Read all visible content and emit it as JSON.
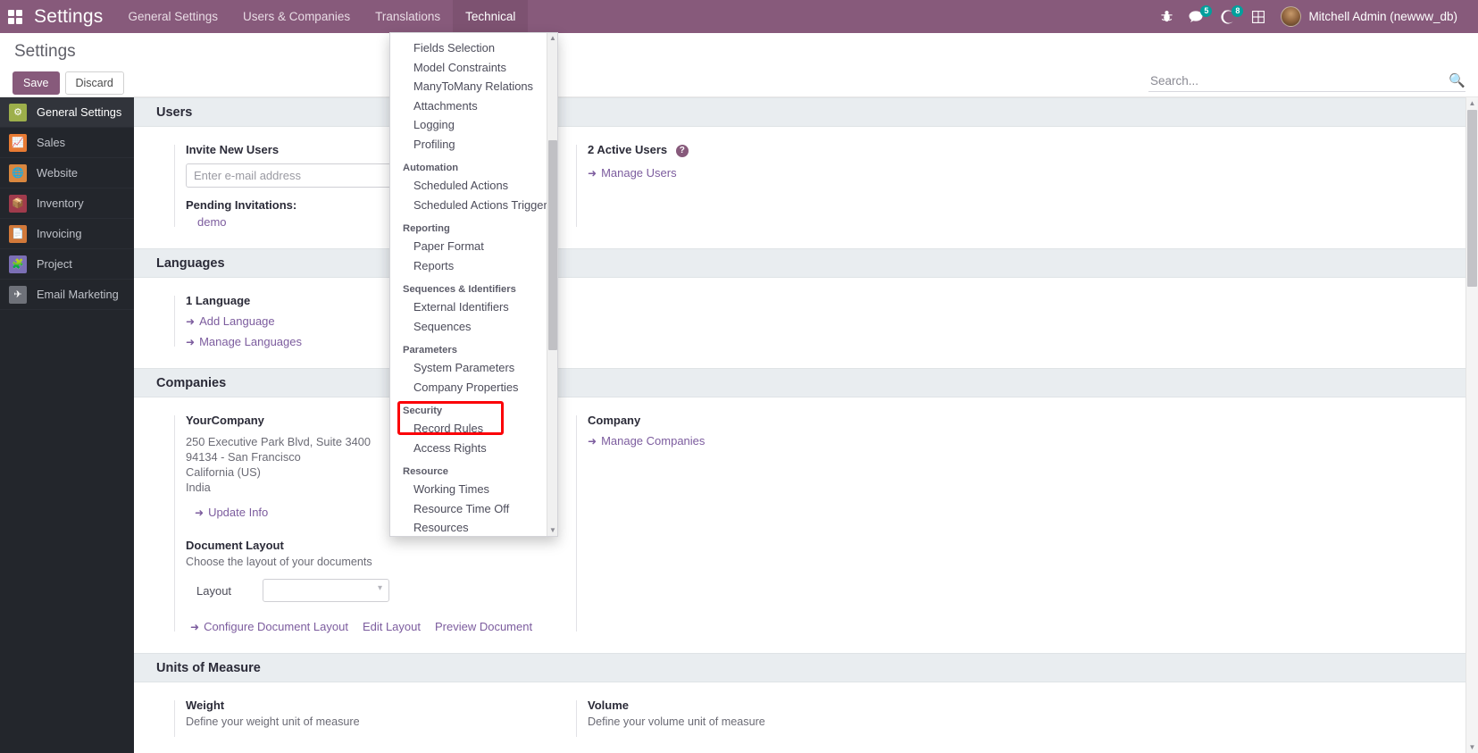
{
  "topbar": {
    "apps_icon": "grid-apps-icon",
    "brand": "Settings",
    "menus": [
      {
        "label": "General Settings",
        "active": false
      },
      {
        "label": "Users & Companies",
        "active": false
      },
      {
        "label": "Translations",
        "active": false
      },
      {
        "label": "Technical",
        "active": true
      }
    ],
    "systray": {
      "debug_icon": "bug-icon",
      "messages_icon": "chat-bubble-icon",
      "messages_count": "5",
      "activities_icon": "clock-activity-icon",
      "activities_count": "8",
      "apps_grid_icon": "grid-plus-icon"
    },
    "user": "Mitchell Admin (newww_db)"
  },
  "control_panel": {
    "title": "Settings",
    "save_label": "Save",
    "discard_label": "Discard",
    "search_placeholder": "Search...",
    "search_value": "",
    "search_icon": "magnifier-icon"
  },
  "sidebar": {
    "items": [
      {
        "label": "General Settings",
        "icon": "gear-icon",
        "color": "#9DAF4B",
        "active": true
      },
      {
        "label": "Sales",
        "icon": "chart-line-icon",
        "color": "#E87B33",
        "active": false
      },
      {
        "label": "Website",
        "icon": "globe-icon",
        "color": "#D9873F",
        "active": false
      },
      {
        "label": "Inventory",
        "icon": "box-open-icon",
        "color": "#A03B4C",
        "active": false
      },
      {
        "label": "Invoicing",
        "icon": "invoice-icon",
        "color": "#D2793A",
        "active": false
      },
      {
        "label": "Project",
        "icon": "puzzle-icon",
        "color": "#7B6FB5",
        "active": false
      },
      {
        "label": "Email Marketing",
        "icon": "paper-plane-icon",
        "color": "#6E7179",
        "active": false
      }
    ]
  },
  "sections": {
    "users": {
      "header": "Users",
      "invite_label": "Invite New Users",
      "invite_placeholder": "Enter e-mail address",
      "invite_value": "",
      "pending_label": "Pending Invitations:",
      "pending_items": [
        "demo"
      ],
      "active_users_label": "2 Active Users",
      "active_users_help": "help-icon",
      "manage_users_link": "Manage Users"
    },
    "languages": {
      "header": "Languages",
      "count_label": "1 Language",
      "add_link": "Add Language",
      "manage_link": "Manage Languages"
    },
    "companies": {
      "header": "Companies",
      "company_name": "YourCompany",
      "address_lines": [
        "250 Executive Park Blvd, Suite 3400",
        "94134 - San Francisco",
        "California (US)",
        "India"
      ],
      "update_info_link": "Update Info",
      "right_title": "Company",
      "manage_companies_link": "Manage Companies",
      "document_layout_label": "Document Layout",
      "document_layout_sub": "Choose the layout of your documents",
      "layout_field_label": "Layout",
      "layout_value": "",
      "configure_link": "Configure Document Layout",
      "edit_layout_link": "Edit Layout",
      "preview_link": "Preview Document"
    },
    "uom": {
      "header": "Units of Measure",
      "weight_label": "Weight",
      "weight_sub": "Define your weight unit of measure",
      "volume_label": "Volume",
      "volume_sub": "Define your volume unit of measure"
    }
  },
  "dropdown": {
    "entries": [
      {
        "type": "item",
        "label": "Fields Selection"
      },
      {
        "type": "item",
        "label": "Model Constraints"
      },
      {
        "type": "item",
        "label": "ManyToMany Relations"
      },
      {
        "type": "item",
        "label": "Attachments"
      },
      {
        "type": "item",
        "label": "Logging"
      },
      {
        "type": "item",
        "label": "Profiling"
      },
      {
        "type": "group",
        "label": "Automation"
      },
      {
        "type": "item",
        "label": "Scheduled Actions"
      },
      {
        "type": "item",
        "label": "Scheduled Actions Triggers"
      },
      {
        "type": "group",
        "label": "Reporting"
      },
      {
        "type": "item",
        "label": "Paper Format"
      },
      {
        "type": "item",
        "label": "Reports"
      },
      {
        "type": "group",
        "label": "Sequences & Identifiers"
      },
      {
        "type": "item",
        "label": "External Identifiers"
      },
      {
        "type": "item",
        "label": "Sequences"
      },
      {
        "type": "group",
        "label": "Parameters"
      },
      {
        "type": "item",
        "label": "System Parameters"
      },
      {
        "type": "item",
        "label": "Company Properties"
      },
      {
        "type": "group",
        "label": "Security"
      },
      {
        "type": "item",
        "label": "Record Rules"
      },
      {
        "type": "item",
        "label": "Access Rights"
      },
      {
        "type": "group",
        "label": "Resource"
      },
      {
        "type": "item",
        "label": "Working Times"
      },
      {
        "type": "item",
        "label": "Resource Time Off"
      },
      {
        "type": "item",
        "label": "Resources"
      }
    ],
    "highlight_color": "#fb0007",
    "highlighted_items": [
      "Security",
      "Record Rules"
    ],
    "scroll_up_icon": "caret-up-icon",
    "scroll_down_icon": "caret-down-icon"
  },
  "colors": {
    "brand_purple": "#875A7B",
    "badge_teal": "#00A09D",
    "link_purple": "#7c5c9e",
    "sidebar_dark": "#23262c",
    "section_header_bg": "#e9edf0"
  }
}
